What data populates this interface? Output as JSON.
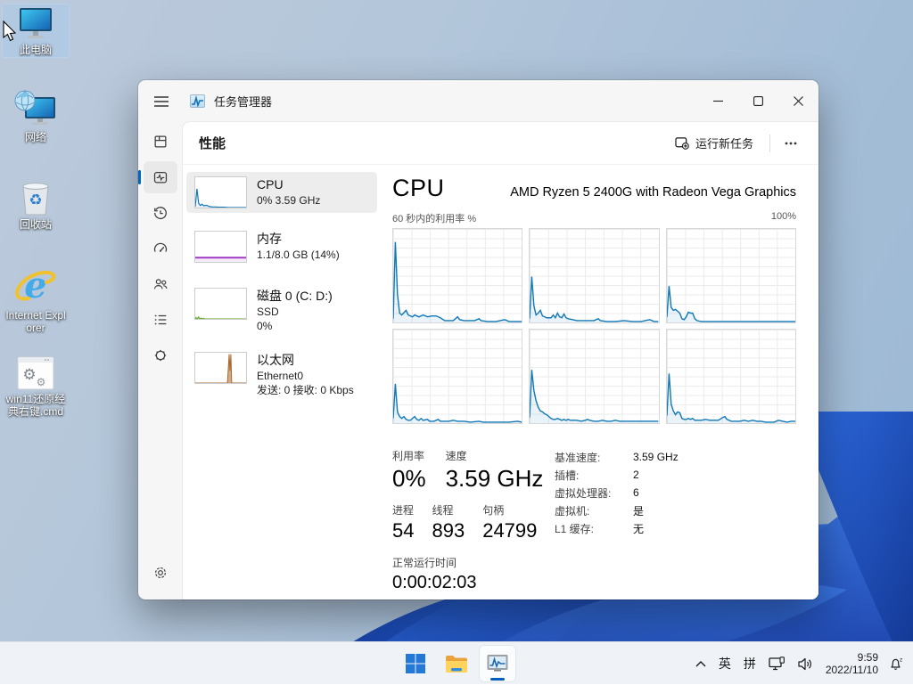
{
  "desktop": {
    "icons": [
      {
        "label": "此电脑",
        "selected": true
      },
      {
        "label": "网络",
        "selected": false
      },
      {
        "label": "回收站",
        "selected": false
      },
      {
        "label": "Internet Explorer",
        "selected": false
      },
      {
        "label": "win11还原经典右键.cmd",
        "selected": false
      }
    ]
  },
  "window": {
    "title": "任务管理器",
    "page_title": "性能",
    "run_new_task": "运行新任务"
  },
  "icons": {
    "titlebar": [
      "hamburger-menu-icon",
      "task-manager-app-icon",
      "minimize-icon",
      "maximize-icon",
      "close-icon"
    ],
    "rail": [
      "processes-icon",
      "performance-icon",
      "app-history-icon",
      "startup-apps-icon",
      "users-icon",
      "details-icon",
      "services-icon",
      "settings-gear-icon"
    ],
    "tray": [
      "chevron-up-icon",
      "network-icon",
      "speaker-icon",
      "focus-assist-bell-icon"
    ]
  },
  "perf_list": [
    {
      "title": "CPU",
      "line2": "0% 3.59 GHz"
    },
    {
      "title": "内存",
      "line2": "1.1/8.0 GB (14%)"
    },
    {
      "title": "磁盘 0 (C: D:)",
      "line2": "SSD",
      "line3": "0%"
    },
    {
      "title": "以太网",
      "line2": "Ethernet0",
      "line3": "发送: 0 接收: 0 Kbps"
    }
  ],
  "cpu": {
    "heading": "CPU",
    "subtitle": "AMD Ryzen 5 2400G with Radeon Vega Graphics",
    "axis_top_left": "60 秒内的利用率 %",
    "axis_top_right": "100%",
    "stats": {
      "util_label": "利用率",
      "util_value": "0%",
      "speed_label": "速度",
      "speed_value": "3.59 GHz",
      "proc_label": "进程",
      "proc_value": "54",
      "thread_label": "线程",
      "thread_value": "893",
      "handle_label": "句柄",
      "handle_value": "24799",
      "uptime_label": "正常运行时间",
      "uptime_value": "0:00:02:03"
    },
    "details": [
      {
        "label": "基准速度:",
        "value": "3.59 GHz"
      },
      {
        "label": "插槽:",
        "value": "2"
      },
      {
        "label": "虚拟处理器:",
        "value": "6"
      },
      {
        "label": "虚拟机:",
        "value": "是"
      },
      {
        "label": "L1 缓存:",
        "value": "无"
      }
    ]
  },
  "chart_data": {
    "type": "line",
    "title": "60 秒内的利用率 %",
    "ylim": [
      0,
      100
    ],
    "window_seconds": 60,
    "legend": "six logical processor utilization graphs, 2 rows x 3 cols",
    "graphs": {
      "core1": {
        "stroke": "#1178b8",
        "fill": "rgba(17,120,184,0.09)",
        "w": 1.4,
        "points": [
          [
            0,
            4
          ],
          [
            1,
            86
          ],
          [
            2,
            30
          ],
          [
            3,
            10
          ],
          [
            4,
            8
          ],
          [
            6,
            13
          ],
          [
            7,
            8
          ],
          [
            9,
            6
          ],
          [
            10,
            8
          ],
          [
            12,
            6
          ],
          [
            14,
            8
          ],
          [
            16,
            6
          ],
          [
            18,
            7
          ],
          [
            20,
            7
          ],
          [
            22,
            5
          ],
          [
            24,
            2
          ],
          [
            26,
            2
          ],
          [
            28,
            2
          ],
          [
            30,
            6
          ],
          [
            31,
            3
          ],
          [
            33,
            2
          ],
          [
            36,
            2
          ],
          [
            38,
            2
          ],
          [
            40,
            4
          ],
          [
            41,
            2
          ],
          [
            44,
            1
          ],
          [
            48,
            1
          ],
          [
            52,
            3
          ],
          [
            54,
            1
          ],
          [
            58,
            1
          ],
          [
            60,
            1
          ]
        ]
      },
      "core2": {
        "stroke": "#1178b8",
        "fill": "rgba(17,120,184,0.09)",
        "w": 1.4,
        "points": [
          [
            0,
            4
          ],
          [
            1,
            49
          ],
          [
            2,
            18
          ],
          [
            3,
            8
          ],
          [
            4,
            10
          ],
          [
            5,
            13
          ],
          [
            6,
            7
          ],
          [
            8,
            5
          ],
          [
            10,
            5
          ],
          [
            11,
            8
          ],
          [
            12,
            5
          ],
          [
            13,
            10
          ],
          [
            14,
            6
          ],
          [
            15,
            5
          ],
          [
            16,
            9
          ],
          [
            17,
            5
          ],
          [
            18,
            4
          ],
          [
            20,
            3
          ],
          [
            22,
            2
          ],
          [
            26,
            2
          ],
          [
            30,
            2
          ],
          [
            32,
            4
          ],
          [
            33,
            2
          ],
          [
            36,
            1
          ],
          [
            40,
            1
          ],
          [
            44,
            2
          ],
          [
            48,
            1
          ],
          [
            52,
            1
          ],
          [
            56,
            3
          ],
          [
            58,
            1
          ],
          [
            60,
            1
          ]
        ]
      },
      "core3": {
        "stroke": "#1178b8",
        "fill": "rgba(17,120,184,0.09)",
        "w": 1.4,
        "points": [
          [
            0,
            6
          ],
          [
            1,
            39
          ],
          [
            2,
            16
          ],
          [
            3,
            13
          ],
          [
            4,
            14
          ],
          [
            5,
            12
          ],
          [
            6,
            10
          ],
          [
            7,
            4
          ],
          [
            8,
            3
          ],
          [
            9,
            6
          ],
          [
            10,
            11
          ],
          [
            11,
            10
          ],
          [
            12,
            10
          ],
          [
            13,
            4
          ],
          [
            14,
            2
          ],
          [
            16,
            1
          ],
          [
            20,
            1
          ],
          [
            24,
            1
          ],
          [
            28,
            1
          ],
          [
            32,
            1
          ],
          [
            36,
            1
          ],
          [
            40,
            1
          ],
          [
            44,
            1
          ],
          [
            48,
            1
          ],
          [
            52,
            1
          ],
          [
            56,
            1
          ],
          [
            60,
            1
          ]
        ]
      },
      "core4": {
        "stroke": "#1178b8",
        "fill": "rgba(17,120,184,0.09)",
        "w": 1.4,
        "points": [
          [
            0,
            5
          ],
          [
            1,
            42
          ],
          [
            2,
            12
          ],
          [
            3,
            7
          ],
          [
            4,
            5
          ],
          [
            5,
            7
          ],
          [
            6,
            4
          ],
          [
            7,
            3
          ],
          [
            8,
            3
          ],
          [
            10,
            7
          ],
          [
            11,
            4
          ],
          [
            12,
            3
          ],
          [
            13,
            5
          ],
          [
            14,
            3
          ],
          [
            16,
            4
          ],
          [
            17,
            2
          ],
          [
            19,
            2
          ],
          [
            21,
            4
          ],
          [
            22,
            2
          ],
          [
            24,
            2
          ],
          [
            26,
            2
          ],
          [
            28,
            3
          ],
          [
            30,
            2
          ],
          [
            33,
            2
          ],
          [
            36,
            1
          ],
          [
            40,
            2
          ],
          [
            42,
            1
          ],
          [
            46,
            1
          ],
          [
            50,
            1
          ],
          [
            54,
            1
          ],
          [
            58,
            2
          ],
          [
            60,
            1
          ]
        ]
      },
      "core5": {
        "stroke": "#1178b8",
        "fill": "rgba(17,120,184,0.09)",
        "w": 1.4,
        "points": [
          [
            0,
            6
          ],
          [
            1,
            57
          ],
          [
            2,
            35
          ],
          [
            3,
            24
          ],
          [
            4,
            17
          ],
          [
            5,
            13
          ],
          [
            6,
            12
          ],
          [
            7,
            10
          ],
          [
            8,
            9
          ],
          [
            9,
            7
          ],
          [
            10,
            5
          ],
          [
            11,
            4
          ],
          [
            12,
            4
          ],
          [
            13,
            5
          ],
          [
            14,
            4
          ],
          [
            15,
            3
          ],
          [
            16,
            4
          ],
          [
            17,
            3
          ],
          [
            18,
            4
          ],
          [
            19,
            3
          ],
          [
            20,
            3
          ],
          [
            22,
            3
          ],
          [
            24,
            2
          ],
          [
            26,
            3
          ],
          [
            27,
            4
          ],
          [
            28,
            3
          ],
          [
            30,
            2
          ],
          [
            32,
            2
          ],
          [
            34,
            3
          ],
          [
            36,
            2
          ],
          [
            38,
            2
          ],
          [
            40,
            3
          ],
          [
            42,
            2
          ],
          [
            44,
            2
          ],
          [
            46,
            2
          ],
          [
            48,
            2
          ],
          [
            50,
            2
          ],
          [
            52,
            2
          ],
          [
            54,
            2
          ],
          [
            56,
            2
          ],
          [
            58,
            2
          ],
          [
            60,
            2
          ]
        ]
      },
      "core6": {
        "stroke": "#1178b8",
        "fill": "rgba(17,120,184,0.09)",
        "w": 1.4,
        "points": [
          [
            0,
            8
          ],
          [
            1,
            53
          ],
          [
            2,
            20
          ],
          [
            3,
            13
          ],
          [
            4,
            9
          ],
          [
            5,
            12
          ],
          [
            6,
            11
          ],
          [
            7,
            5
          ],
          [
            8,
            4
          ],
          [
            9,
            4
          ],
          [
            10,
            5
          ],
          [
            11,
            4
          ],
          [
            12,
            5
          ],
          [
            13,
            3
          ],
          [
            14,
            3
          ],
          [
            16,
            3
          ],
          [
            18,
            4
          ],
          [
            20,
            3
          ],
          [
            22,
            3
          ],
          [
            24,
            3
          ],
          [
            26,
            6
          ],
          [
            27,
            7
          ],
          [
            28,
            4
          ],
          [
            30,
            2
          ],
          [
            32,
            2
          ],
          [
            34,
            2
          ],
          [
            36,
            3
          ],
          [
            38,
            2
          ],
          [
            40,
            3
          ],
          [
            42,
            2
          ],
          [
            44,
            2
          ],
          [
            46,
            1
          ],
          [
            48,
            1
          ],
          [
            50,
            1
          ],
          [
            52,
            3
          ],
          [
            54,
            2
          ],
          [
            56,
            1
          ],
          [
            58,
            2
          ],
          [
            60,
            2
          ]
        ]
      },
      "cpu_mini": {
        "stroke": "#1178b8",
        "fill": "rgba(17,120,184,0.09)",
        "w": 1.2,
        "points": [
          [
            0,
            3
          ],
          [
            2,
            62
          ],
          [
            4,
            14
          ],
          [
            6,
            7
          ],
          [
            8,
            11
          ],
          [
            10,
            6
          ],
          [
            12,
            7
          ],
          [
            14,
            7
          ],
          [
            16,
            4
          ],
          [
            18,
            3
          ],
          [
            20,
            2
          ],
          [
            24,
            2
          ],
          [
            28,
            1
          ],
          [
            34,
            1
          ],
          [
            40,
            0
          ],
          [
            60,
            0
          ]
        ]
      },
      "mem_mini": {
        "stroke": "#a33bc6",
        "fill": "rgba(163,59,198,0.10)",
        "w": 2,
        "points": [
          [
            0,
            14
          ],
          [
            60,
            14
          ]
        ]
      },
      "disk_mini": {
        "stroke": "#5ba829",
        "fill": "rgba(91,168,41,0.45)",
        "w": 1,
        "points": [
          [
            0,
            0
          ],
          [
            1,
            5
          ],
          [
            2,
            0
          ],
          [
            4,
            7
          ],
          [
            5,
            0
          ],
          [
            7,
            3
          ],
          [
            8,
            0
          ],
          [
            10,
            2
          ],
          [
            11,
            0
          ],
          [
            60,
            0
          ]
        ]
      },
      "eth_mini": {
        "stroke": "#a9682b",
        "fill": "rgba(169,104,43,0.55)",
        "w": 1,
        "points": [
          [
            0,
            0
          ],
          [
            38,
            0
          ],
          [
            40,
            95
          ],
          [
            41,
            40
          ],
          [
            42,
            95
          ],
          [
            43,
            0
          ],
          [
            60,
            0
          ]
        ]
      }
    }
  },
  "taskbar": {
    "ime1": "英",
    "ime2": "拼",
    "time": "9:59",
    "date": "2022/11/10"
  }
}
